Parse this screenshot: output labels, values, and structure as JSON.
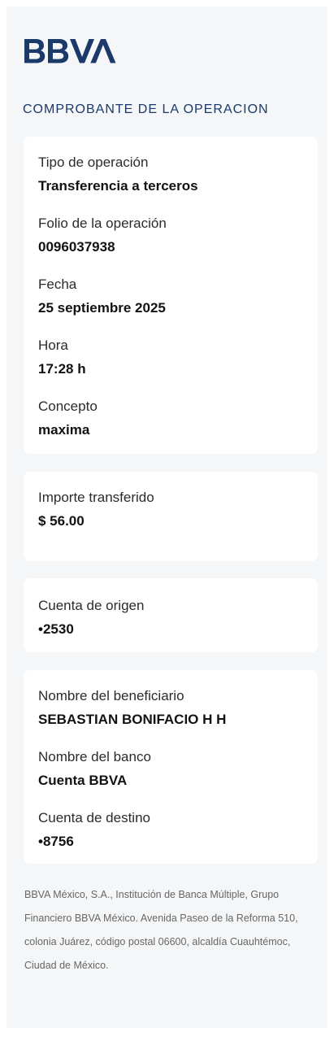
{
  "brand": {
    "name": "BBVA",
    "color": "#1b3a6a"
  },
  "receipt": {
    "title": "COMPROBANTE DE LA OPERACION"
  },
  "operation": {
    "type_label": "Tipo de operación",
    "type_value": "Transferencia a terceros",
    "folio_label": "Folio de la operación",
    "folio_value": "0096037938",
    "date_label": "Fecha",
    "date_value": "25 septiembre 2025",
    "time_label": "Hora",
    "time_value": "17:28 h",
    "concept_label": "Concepto",
    "concept_value": "maxima"
  },
  "amount": {
    "label": "Importe transferido",
    "value": "$ 56.00"
  },
  "origin": {
    "label": "Cuenta de origen",
    "value": "•2530"
  },
  "beneficiary": {
    "name_label": "Nombre del beneficiario",
    "name_value": "SEBASTIAN BONIFACIO H H",
    "bank_label": "Nombre del banco",
    "bank_value": "Cuenta BBVA",
    "account_label": "Cuenta de destino",
    "account_value": "•8756"
  },
  "footer": {
    "legal_text": "BBVA México, S.A., Institución de Banca Múltiple, Grupo Financiero BBVA México. Avenida Paseo de la Reforma 510, colonia Juárez, código postal 06600, alcaldía Cuauhtémoc, Ciudad de México."
  }
}
